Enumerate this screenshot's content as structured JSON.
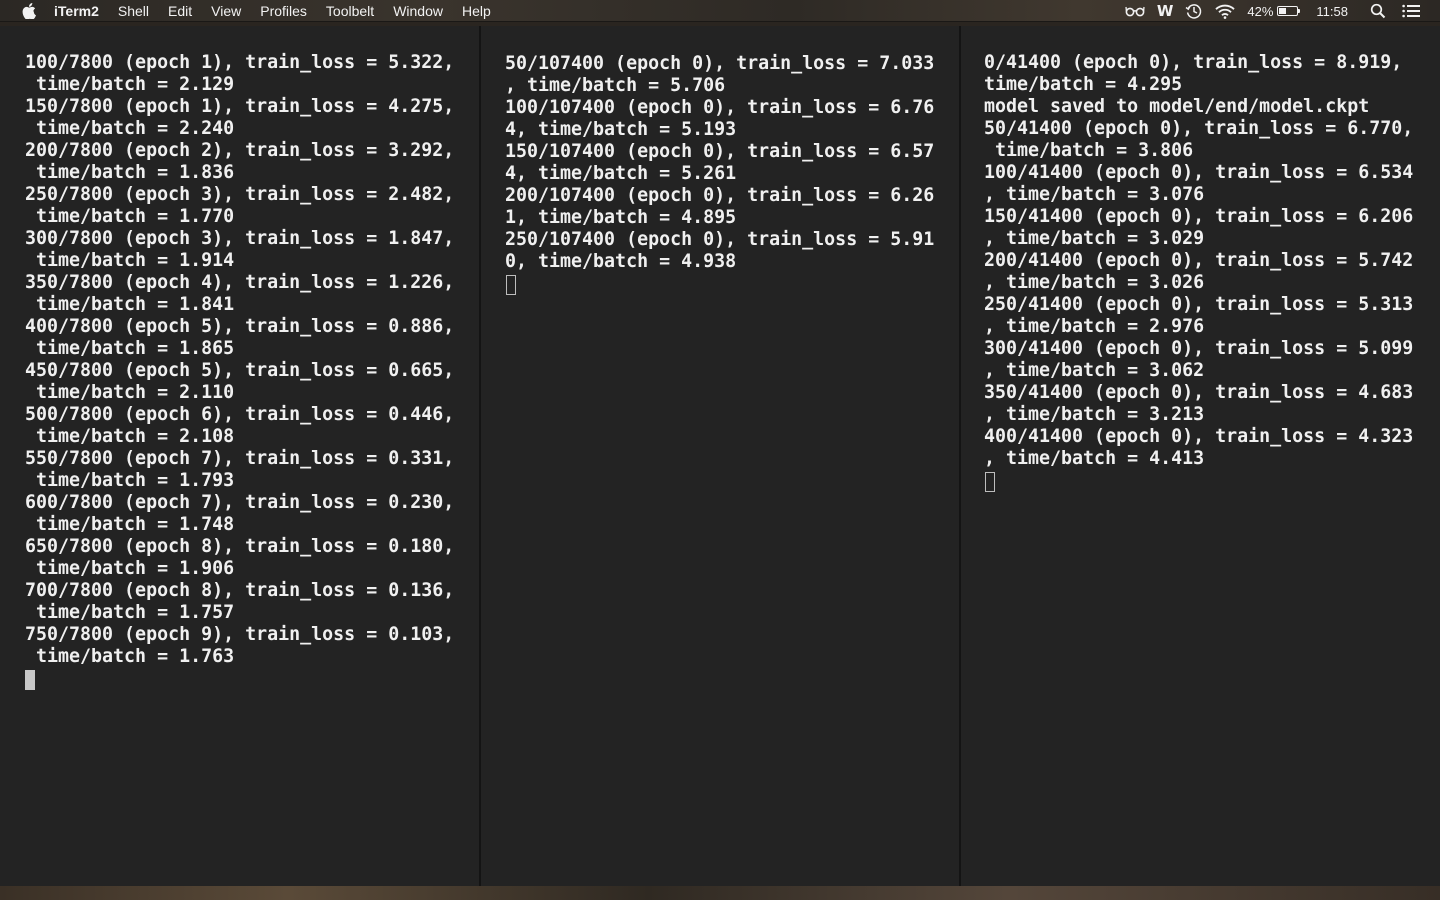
{
  "menubar": {
    "app_name": "iTerm2",
    "items": [
      "Shell",
      "Edit",
      "View",
      "Profiles",
      "Toolbelt",
      "Window",
      "Help"
    ],
    "status": {
      "battery_percent": "42%",
      "battery_level": 0.42,
      "clock": "11:58",
      "icons": [
        "glasses-icon",
        "w-icon",
        "time-machine-icon",
        "wifi-icon",
        "battery-icon",
        "search-icon",
        "list-icon"
      ],
      "w_glyph": "W"
    }
  },
  "panes": [
    {
      "lines": [
        "100/7800 (epoch 1), train_loss = 5.322,",
        " time/batch = 2.129",
        "150/7800 (epoch 1), train_loss = 4.275,",
        " time/batch = 2.240",
        "200/7800 (epoch 2), train_loss = 3.292,",
        " time/batch = 1.836",
        "250/7800 (epoch 3), train_loss = 2.482,",
        " time/batch = 1.770",
        "300/7800 (epoch 3), train_loss = 1.847,",
        " time/batch = 1.914",
        "350/7800 (epoch 4), train_loss = 1.226,",
        " time/batch = 1.841",
        "400/7800 (epoch 5), train_loss = 0.886,",
        " time/batch = 1.865",
        "450/7800 (epoch 5), train_loss = 0.665,",
        " time/batch = 2.110",
        "500/7800 (epoch 6), train_loss = 0.446,",
        " time/batch = 2.108",
        "550/7800 (epoch 7), train_loss = 0.331,",
        " time/batch = 1.793",
        "600/7800 (epoch 7), train_loss = 0.230,",
        " time/batch = 1.748",
        "650/7800 (epoch 8), train_loss = 0.180,",
        " time/batch = 1.906",
        "700/7800 (epoch 8), train_loss = 0.136,",
        " time/batch = 1.757",
        "750/7800 (epoch 9), train_loss = 0.103,",
        " time/batch = 1.763"
      ]
    },
    {
      "lines": [
        "50/107400 (epoch 0), train_loss = 7.033",
        ", time/batch = 5.706",
        "100/107400 (epoch 0), train_loss = 6.76",
        "4, time/batch = 5.193",
        "150/107400 (epoch 0), train_loss = 6.57",
        "4, time/batch = 5.261",
        "200/107400 (epoch 0), train_loss = 6.26",
        "1, time/batch = 4.895",
        "250/107400 (epoch 0), train_loss = 5.91",
        "0, time/batch = 4.938"
      ]
    },
    {
      "lines": [
        "0/41400 (epoch 0), train_loss = 8.919,",
        "time/batch = 4.295",
        "model saved to model/end/model.ckpt",
        "50/41400 (epoch 0), train_loss = 6.770,",
        " time/batch = 3.806",
        "100/41400 (epoch 0), train_loss = 6.534",
        ", time/batch = 3.076",
        "150/41400 (epoch 0), train_loss = 6.206",
        ", time/batch = 3.029",
        "200/41400 (epoch 0), train_loss = 5.742",
        ", time/batch = 3.026",
        "250/41400 (epoch 0), train_loss = 5.313",
        ", time/batch = 2.976",
        "300/41400 (epoch 0), train_loss = 5.099",
        ", time/batch = 3.062",
        "350/41400 (epoch 0), train_loss = 4.683",
        ", time/batch = 3.213",
        "400/41400 (epoch 0), train_loss = 4.323",
        ", time/batch = 4.413"
      ]
    }
  ]
}
